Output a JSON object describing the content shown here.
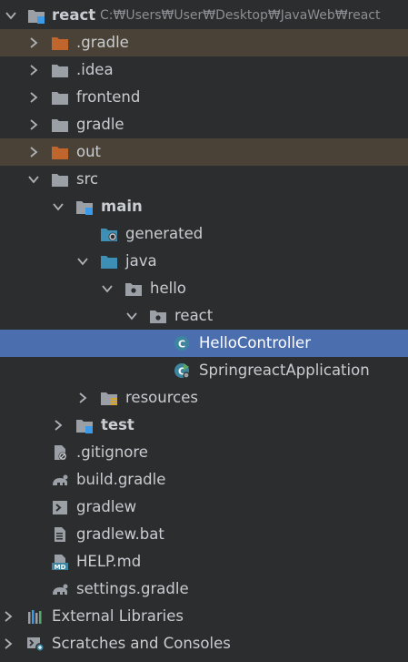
{
  "project": {
    "name": "react",
    "path": "C:₩Users₩User₩Desktop₩JavaWeb₩react"
  },
  "tree": {
    "gradle_dir": ".gradle",
    "idea_dir": ".idea",
    "frontend_dir": "frontend",
    "gradle_wrapper_dir": "gradle",
    "out_dir": "out",
    "src_dir": "src",
    "main_dir": "main",
    "generated_dir": "generated",
    "java_dir": "java",
    "hello_pkg": "hello",
    "react_pkg": "react",
    "hello_controller": "HelloController",
    "springreact_app": "SpringreactApplication",
    "resources_dir": "resources",
    "test_dir": "test",
    "gitignore": ".gitignore",
    "build_gradle": "build.gradle",
    "gradlew": "gradlew",
    "gradlew_bat": "gradlew.bat",
    "help_md": "HELP.md",
    "settings_gradle": "settings.gradle"
  },
  "bottom": {
    "external_libraries": "External Libraries",
    "scratches": "Scratches and Consoles"
  },
  "colors": {
    "background": "#2b2d2f",
    "excluded_row": "#4a4236",
    "selected_row": "#4b6eaf",
    "folder_gray": "#9aa0a6",
    "folder_excluded": "#c0652c",
    "folder_source": "#3d8fb5",
    "class_blue": "#3e86a0"
  }
}
